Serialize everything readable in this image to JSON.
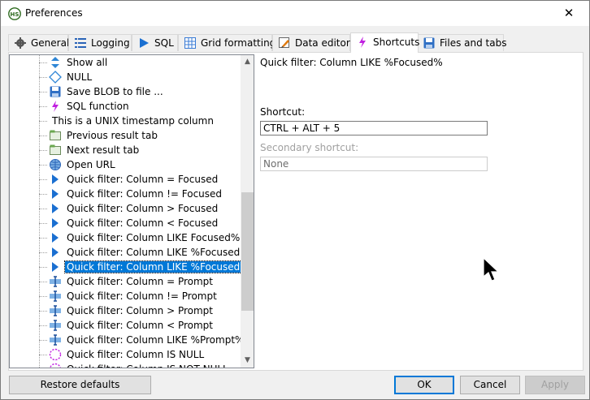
{
  "window": {
    "title": "Preferences",
    "close_glyph": "✕"
  },
  "tabs": [
    {
      "label": "General",
      "icon": "gear-icon"
    },
    {
      "label": "Logging",
      "icon": "list-icon"
    },
    {
      "label": "SQL",
      "icon": "play-icon"
    },
    {
      "label": "Grid formatting",
      "icon": "grid-icon"
    },
    {
      "label": "Data editors",
      "icon": "pencil-icon"
    },
    {
      "label": "Shortcuts",
      "icon": "lightning-icon",
      "active": true
    },
    {
      "label": "Files and tabs",
      "icon": "floppy-icon"
    }
  ],
  "tree": {
    "items": [
      {
        "label": "Show all",
        "icon": "up-down-arrows-icon"
      },
      {
        "label": "NULL",
        "icon": "diamond-icon"
      },
      {
        "label": "Save BLOB to file ...",
        "icon": "floppy-icon"
      },
      {
        "label": "SQL function",
        "icon": "lightning-icon"
      },
      {
        "label": "This is a UNIX timestamp column",
        "icon": ""
      },
      {
        "label": "Previous result tab",
        "icon": "tab-icon"
      },
      {
        "label": "Next result tab",
        "icon": "tab-icon"
      },
      {
        "label": "Open URL",
        "icon": "globe-icon"
      },
      {
        "label": "Quick filter: Column = Focused",
        "icon": "filter-arrow-icon"
      },
      {
        "label": "Quick filter: Column != Focused",
        "icon": "filter-arrow-icon"
      },
      {
        "label": "Quick filter: Column > Focused",
        "icon": "filter-arrow-icon"
      },
      {
        "label": "Quick filter: Column < Focused",
        "icon": "filter-arrow-icon"
      },
      {
        "label": "Quick filter: Column LIKE Focused%",
        "icon": "filter-arrow-icon"
      },
      {
        "label": "Quick filter: Column LIKE %Focused",
        "icon": "filter-arrow-icon"
      },
      {
        "label": "Quick filter: Column LIKE %Focused%",
        "icon": "filter-arrow-icon",
        "selected": true
      },
      {
        "label": "Quick filter: Column = Prompt",
        "icon": "prompt-filter-icon"
      },
      {
        "label": "Quick filter: Column != Prompt",
        "icon": "prompt-filter-icon"
      },
      {
        "label": "Quick filter: Column > Prompt",
        "icon": "prompt-filter-icon"
      },
      {
        "label": "Quick filter: Column < Prompt",
        "icon": "prompt-filter-icon"
      },
      {
        "label": "Quick filter: Column LIKE %Prompt%",
        "icon": "prompt-filter-icon"
      },
      {
        "label": "Quick filter: Column IS NULL",
        "icon": "dashed-circle-icon"
      },
      {
        "label": "Quick filter: Column IS NOT NULL",
        "icon": "dashed-circle-icon"
      }
    ],
    "scroll_up_glyph": "▲",
    "scroll_down_glyph": "▼"
  },
  "detail": {
    "action_name": "Quick filter: Column LIKE %Focused%",
    "shortcut_label": "Shortcut:",
    "shortcut_value": "CTRL + ALT + 5",
    "secondary_label": "Secondary shortcut:",
    "secondary_value": "None"
  },
  "buttons": {
    "restore": "Restore defaults",
    "ok": "OK",
    "cancel": "Cancel",
    "apply": "Apply"
  },
  "colors": {
    "selection": "#0078d7",
    "accent": "#0078d7"
  }
}
